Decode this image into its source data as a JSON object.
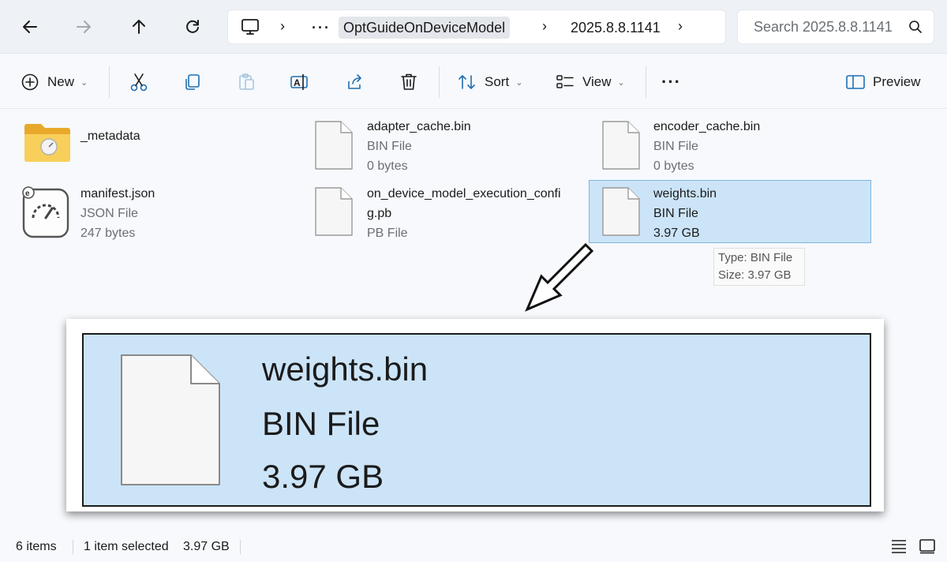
{
  "addressbar": {
    "crumbs": [
      "OptGuideOnDeviceModel",
      "2025.8.8.1141"
    ],
    "overflow": "···",
    "search_placeholder": "Search 2025.8.8.1141"
  },
  "toolbar": {
    "new_label": "New",
    "sort_label": "Sort",
    "view_label": "View",
    "more_label": "···",
    "preview_label": "Preview"
  },
  "files": [
    {
      "name": "_metadata",
      "icon": "folder-icon"
    },
    {
      "name": "adapter_cache.bin",
      "type": "BIN File",
      "size": "0 bytes",
      "icon": "file-icon"
    },
    {
      "name": "encoder_cache.bin",
      "type": "BIN File",
      "size": "0 bytes",
      "icon": "file-icon"
    },
    {
      "name": "manifest.json",
      "type": "JSON File",
      "size": "247 bytes",
      "icon": "json-file-icon"
    },
    {
      "name_line1": "on_device_model_execution_confi",
      "name_line2": "g.pb",
      "type": "PB File",
      "icon": "file-icon"
    },
    {
      "name": "weights.bin",
      "type": "BIN File",
      "size": "3.97 GB",
      "icon": "file-icon",
      "selected": true
    }
  ],
  "tooltip": {
    "line1": "Type: BIN File",
    "line2": "Size: 3.97 GB"
  },
  "zoom": {
    "name": "weights.bin",
    "type": "BIN File",
    "size": "3.97 GB"
  },
  "status": {
    "items": "6 items",
    "selected": "1 item selected",
    "selected_size": "3.97 GB"
  },
  "colors": {
    "selection": "#cce4f8",
    "selection_border": "#7fb5df",
    "background": "#f7f9fc"
  }
}
